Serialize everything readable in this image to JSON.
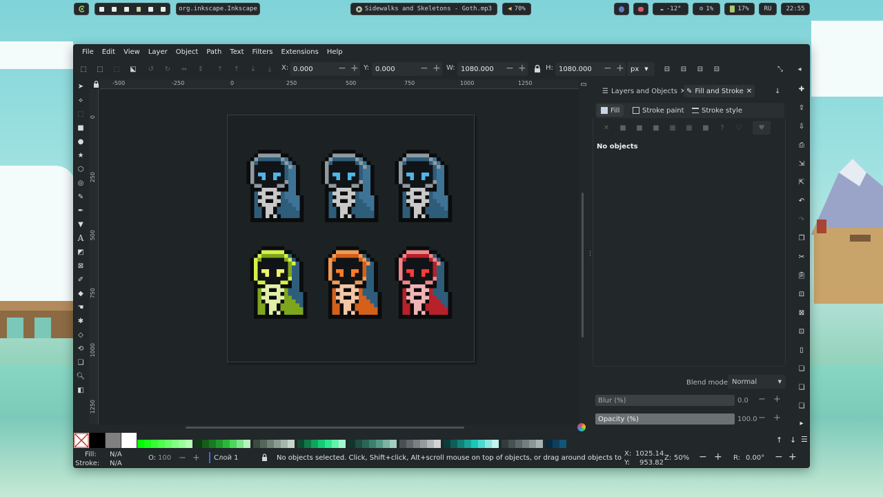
{
  "topbar": {
    "launcher_icon": "power-icon",
    "app_id": "org.inkscape.Inkscape",
    "media": "Sidewalks and Skeletons - Goth.mp3",
    "volume": "70%",
    "weather": "-12°",
    "cpu": "1%",
    "battery": "17%",
    "keyboard_layout": "RU",
    "clock": "22:55"
  },
  "menu": [
    "File",
    "Edit",
    "View",
    "Layer",
    "Object",
    "Path",
    "Text",
    "Filters",
    "Extensions",
    "Help"
  ],
  "transform": {
    "x_label": "X:",
    "x_value": "0.000",
    "y_label": "Y:",
    "y_value": "0.000",
    "w_label": "W:",
    "w_value": "1080.000",
    "h_label": "H:",
    "h_value": "1080.000",
    "unit": "px"
  },
  "ruler": {
    "top_ticks": [
      "-500",
      "-250",
      "0",
      "250",
      "500",
      "750",
      "1000",
      "1250"
    ],
    "left_ticks": [
      "0",
      "250",
      "500",
      "750",
      "1000",
      "1250"
    ]
  },
  "characters": [
    {
      "hood": "#2e5d7a",
      "hood_light": "#3f7396",
      "trim": "#8e9aa0",
      "eyes": "#4fb6e8",
      "bones": "#c9c9c9",
      "robe": "#2e5d7a"
    },
    {
      "hood": "#2e5d7a",
      "hood_light": "#3f7396",
      "trim": "#8e9aa0",
      "eyes": "#4fb6e8",
      "bones": "#c9c9c9",
      "robe": "#2e5d7a"
    },
    {
      "hood": "#2e5d7a",
      "hood_light": "#3f7396",
      "trim": "#8e9aa0",
      "eyes": "#4fb6e8",
      "bones": "#c9c9c9",
      "robe": "#2e5d7a"
    },
    {
      "hood": "#7da61e",
      "hood_light": "#2e5d7a",
      "trim": "#d6f04a",
      "eyes": "#f1f26a",
      "bones": "#e2f0a8",
      "robe": "#7da61e"
    },
    {
      "hood": "#d4601a",
      "hood_light": "#2e5d7a",
      "trim": "#f19a55",
      "eyes": "#ff7a2a",
      "bones": "#f3c6a6",
      "robe": "#d4601a"
    },
    {
      "hood": "#b8202a",
      "hood_light": "#2e5d7a",
      "trim": "#f0868a",
      "eyes": "#ff3a3a",
      "bones": "#f0b4b6",
      "robe": "#b8202a"
    }
  ],
  "dock": {
    "tab_layers": "Layers and Objects",
    "tab_fill_stroke": "Fill and Stroke",
    "subtab_fill": "Fill",
    "subtab_stroke_paint": "Stroke paint",
    "subtab_stroke_style": "Stroke style",
    "no_objects": "No objects",
    "blend_label": "Blend mode:",
    "blend_value": "Normal",
    "blur_label": "Blur (%)",
    "blur_value": "0.0",
    "opacity_label": "Opacity (%)",
    "opacity_value": "100.0"
  },
  "palette": [
    "#00ff00",
    "#1aff1a",
    "#33ff33",
    "#4dff4d",
    "#66ff66",
    "#80ff80",
    "#99ff99",
    "#b3ffb3",
    "#0f3d12",
    "#155e1a",
    "#1a7a22",
    "#20992b",
    "#2bb839",
    "#4dd65c",
    "#7ee58a",
    "#b8f2bf",
    "#3d4a3e",
    "#56645a",
    "#6f8076",
    "#8a9b91",
    "#a7b6ad",
    "#c8d3cc",
    "#0d4d2f",
    "#0f7a46",
    "#12a35e",
    "#14cc75",
    "#2ee68f",
    "#66f0ae",
    "#a3f7cf",
    "#14332a",
    "#1f4d3f",
    "#2b6655",
    "#3d806c",
    "#569985",
    "#7ab3a2",
    "#a4cdc0",
    "#4a4f52",
    "#61676a",
    "#7a8184",
    "#969c9e",
    "#b3b8ba",
    "#d0d4d5",
    "#0b3d3a",
    "#0f5e59",
    "#138078",
    "#17a397",
    "#1bc7b8",
    "#4dd9cc",
    "#8ce8df",
    "#c4f4ef",
    "#333c3d",
    "#465152",
    "#5b6768",
    "#727e7f",
    "#8b9697",
    "#a9b2b3",
    "#0a2a3d",
    "#0e3f5c",
    "#12557a"
  ],
  "status": {
    "fill_label": "Fill:",
    "fill_value": "N/A",
    "stroke_label": "Stroke:",
    "stroke_value": "N/A",
    "opacity_label": "O:",
    "opacity_value": "100",
    "layer": "Слой 1",
    "message": "No objects selected. Click, Shift+click, Alt+scroll mouse on top of objects, or drag around objects to select.",
    "cursor_x_label": "X:",
    "cursor_x": "1025.14",
    "cursor_y_label": "Y:",
    "cursor_y": "953.82",
    "zoom_label": "Z:",
    "zoom": "50%",
    "rotate_label": "R:",
    "rotate": "0.00°"
  }
}
